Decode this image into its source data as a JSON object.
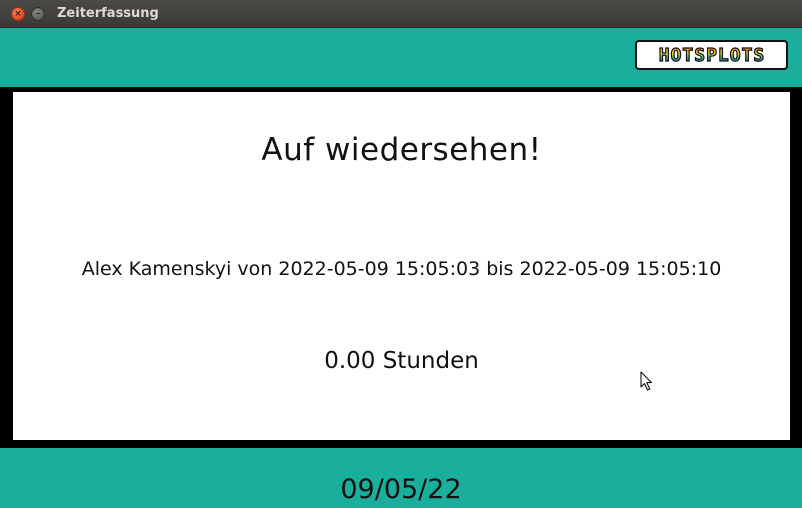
{
  "window": {
    "title": "Zeiterfassung",
    "close_glyph": "×",
    "minimize_glyph": "–"
  },
  "header": {
    "logo_text": "HOTSPLOTS",
    "brand_color": "#1aaf9c"
  },
  "main": {
    "heading": "Auf wiedersehen!",
    "session_text": "Alex Kamenskyi von 2022-05-09 15:05:03 bis 2022-05-09 15:05:10",
    "hours_text": "0.00 Stunden"
  },
  "footer": {
    "date": "09/05/22"
  },
  "colors": {
    "accent": "#1aaf9c",
    "background": "#000000",
    "panel": "#ffffff",
    "close_button": "#e0471a"
  },
  "icons": {
    "close": "close-icon",
    "minimize": "minimize-icon",
    "cursor": "mouse-pointer-icon"
  }
}
